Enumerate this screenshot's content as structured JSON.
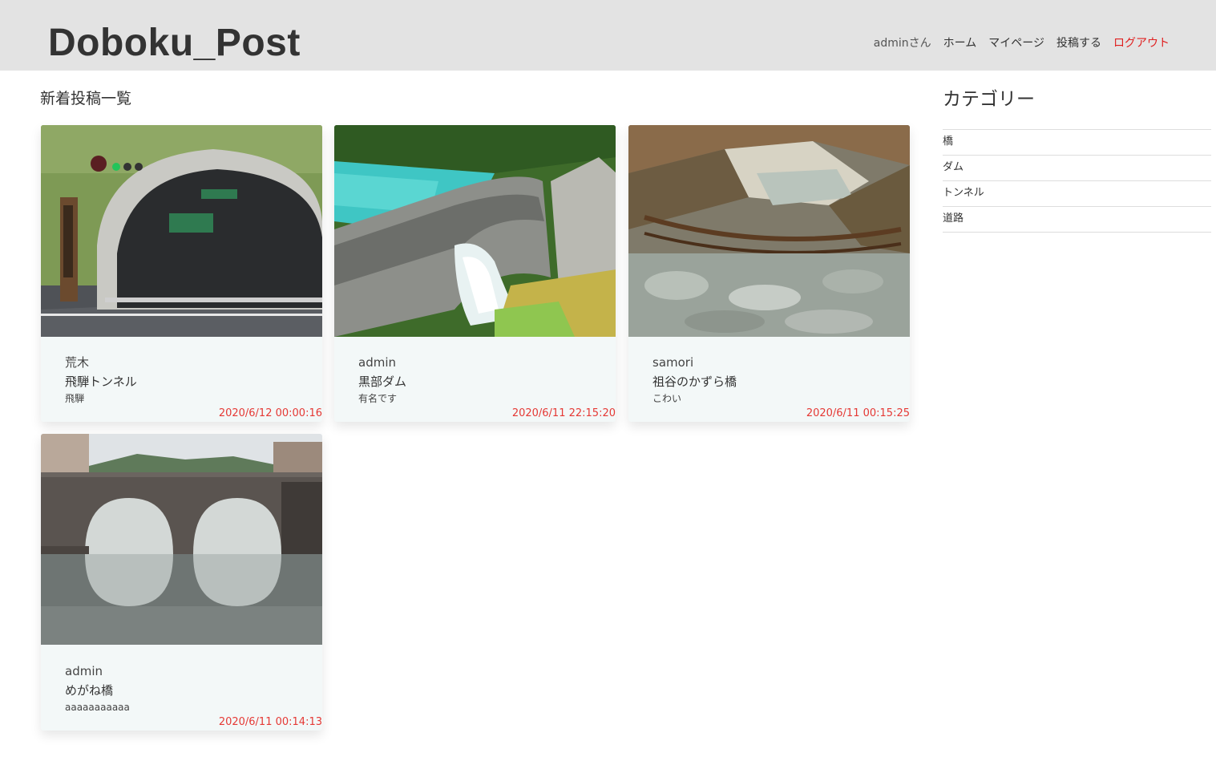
{
  "header": {
    "logo": "Doboku_Post",
    "nav": {
      "user": "adminさん",
      "home": "ホーム",
      "mypage": "マイページ",
      "post": "投稿する",
      "logout": "ログアウト"
    }
  },
  "main": {
    "title": "新着投稿一覧",
    "posts": [
      {
        "author": "荒木",
        "title": "飛騨トンネル",
        "body": "飛騨",
        "date": "2020/6/12 00:00:16",
        "image": "tunnel-photo"
      },
      {
        "author": "admin",
        "title": "黒部ダム",
        "body": "有名です",
        "date": "2020/6/11 22:15:20",
        "image": "dam-photo"
      },
      {
        "author": "samori",
        "title": "祖谷のかずら橋",
        "body": "こわい",
        "date": "2020/6/11 00:15:25",
        "image": "vine-bridge-photo"
      },
      {
        "author": "admin",
        "title": "めがね橋",
        "body": "aaaaaaaaaaa",
        "date": "2020/6/11 00:14:13",
        "image": "stone-bridge-photo"
      }
    ]
  },
  "sidebar": {
    "title": "カテゴリー",
    "categories": [
      "橋",
      "ダム",
      "トンネル",
      "道路"
    ]
  },
  "colors": {
    "header_bg": "#e3e3e3",
    "logout": "#e02020",
    "date": "#e53935",
    "card_bg": "#f3f8f8"
  }
}
